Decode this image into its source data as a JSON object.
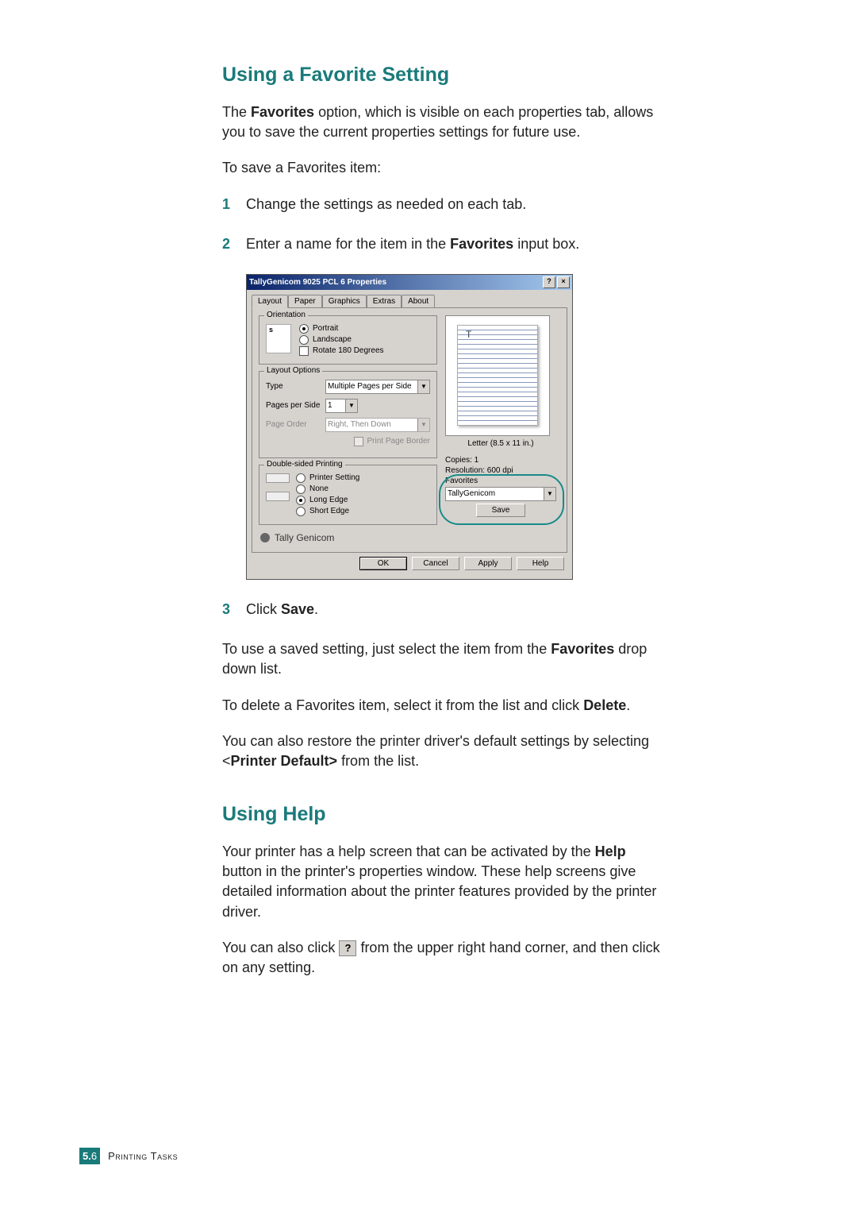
{
  "section1": {
    "heading": "Using a Favorite Setting",
    "intro_pre": "The ",
    "intro_bold": "Favorites",
    "intro_post": " option, which is visible on each properties tab, allows you to save the current properties settings for future use.",
    "lead": "To save a Favorites item:",
    "steps": {
      "n1": "1",
      "s1": "Change the settings as needed on each tab.",
      "n2": "2",
      "s2_pre": "Enter a name for the item in the ",
      "s2_bold": "Favorites",
      "s2_post": " input box.",
      "n3": "3",
      "s3_pre": "Click ",
      "s3_bold": "Save",
      "s3_post": "."
    },
    "use_pre": "To use a saved setting, just select the item from the ",
    "use_bold": "Favorites",
    "use_post": " drop down list.",
    "delete_pre": "To delete a Favorites item, select it from the list and click ",
    "delete_bold": "Delete",
    "delete_post": ".",
    "restore_pre": "You can also restore the printer driver's default settings by selecting <",
    "restore_bold": "Printer Default>",
    "restore_post": " from the list."
  },
  "section2": {
    "heading": "Using Help",
    "para1_pre": "Your printer has a help screen that can be activated by the ",
    "para1_bold": "Help",
    "para1_post": " button in the printer's properties window. These help screens give detailed information about the printer features provided by the printer driver.",
    "para2_pre": "You can also click ",
    "para2_icon": "?",
    "para2_post": " from the upper right hand corner, and then click on any setting."
  },
  "dialog": {
    "title": "TallyGenicom 9025 PCL 6 Properties",
    "help_btn": "?",
    "close_btn": "×",
    "tabs": {
      "layout": "Layout",
      "paper": "Paper",
      "graphics": "Graphics",
      "extras": "Extras",
      "about": "About"
    },
    "orientation": {
      "legend": "Orientation",
      "portrait": "Portrait",
      "landscape": "Landscape",
      "rotate": "Rotate 180 Degrees"
    },
    "layout_options": {
      "legend": "Layout Options",
      "type_label": "Type",
      "type_value": "Multiple Pages per Side",
      "pps_label": "Pages per Side",
      "pps_value": "1",
      "order_label": "Page Order",
      "order_value": "Right, Then Down",
      "border": "Print Page Border"
    },
    "ds": {
      "legend": "Double-sided Printing",
      "printer": "Printer Setting",
      "none": "None",
      "long": "Long Edge",
      "short": "Short Edge"
    },
    "brand": "Tally Genicom",
    "preview_label": "Letter (8.5 x 11 in.)",
    "copies": "Copies: 1",
    "resolution": "Resolution: 600 dpi",
    "favorites_label": "Favorites",
    "favorites_value": "TallyGenicom",
    "save": "Save",
    "ok": "OK",
    "cancel": "Cancel",
    "apply": "Apply",
    "helpbtn": "Help"
  },
  "footer": {
    "chapter": "5.",
    "page": "6",
    "section": "Printing Tasks"
  }
}
